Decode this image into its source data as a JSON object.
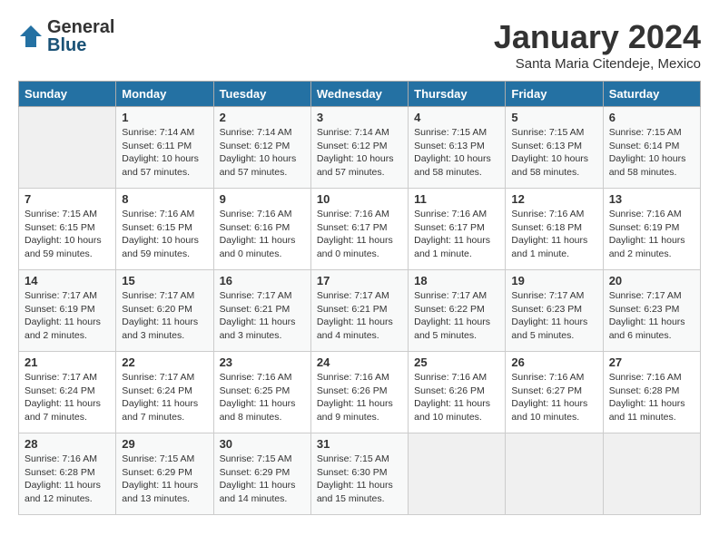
{
  "logo": {
    "general": "General",
    "blue": "Blue"
  },
  "title": "January 2024",
  "location": "Santa Maria Citendeje, Mexico",
  "header_days": [
    "Sunday",
    "Monday",
    "Tuesday",
    "Wednesday",
    "Thursday",
    "Friday",
    "Saturday"
  ],
  "weeks": [
    [
      {
        "day": "",
        "info": ""
      },
      {
        "day": "1",
        "info": "Sunrise: 7:14 AM\nSunset: 6:11 PM\nDaylight: 10 hours\nand 57 minutes."
      },
      {
        "day": "2",
        "info": "Sunrise: 7:14 AM\nSunset: 6:12 PM\nDaylight: 10 hours\nand 57 minutes."
      },
      {
        "day": "3",
        "info": "Sunrise: 7:14 AM\nSunset: 6:12 PM\nDaylight: 10 hours\nand 57 minutes."
      },
      {
        "day": "4",
        "info": "Sunrise: 7:15 AM\nSunset: 6:13 PM\nDaylight: 10 hours\nand 58 minutes."
      },
      {
        "day": "5",
        "info": "Sunrise: 7:15 AM\nSunset: 6:13 PM\nDaylight: 10 hours\nand 58 minutes."
      },
      {
        "day": "6",
        "info": "Sunrise: 7:15 AM\nSunset: 6:14 PM\nDaylight: 10 hours\nand 58 minutes."
      }
    ],
    [
      {
        "day": "7",
        "info": "Sunrise: 7:15 AM\nSunset: 6:15 PM\nDaylight: 10 hours\nand 59 minutes."
      },
      {
        "day": "8",
        "info": "Sunrise: 7:16 AM\nSunset: 6:15 PM\nDaylight: 10 hours\nand 59 minutes."
      },
      {
        "day": "9",
        "info": "Sunrise: 7:16 AM\nSunset: 6:16 PM\nDaylight: 11 hours\nand 0 minutes."
      },
      {
        "day": "10",
        "info": "Sunrise: 7:16 AM\nSunset: 6:17 PM\nDaylight: 11 hours\nand 0 minutes."
      },
      {
        "day": "11",
        "info": "Sunrise: 7:16 AM\nSunset: 6:17 PM\nDaylight: 11 hours\nand 1 minute."
      },
      {
        "day": "12",
        "info": "Sunrise: 7:16 AM\nSunset: 6:18 PM\nDaylight: 11 hours\nand 1 minute."
      },
      {
        "day": "13",
        "info": "Sunrise: 7:16 AM\nSunset: 6:19 PM\nDaylight: 11 hours\nand 2 minutes."
      }
    ],
    [
      {
        "day": "14",
        "info": "Sunrise: 7:17 AM\nSunset: 6:19 PM\nDaylight: 11 hours\nand 2 minutes."
      },
      {
        "day": "15",
        "info": "Sunrise: 7:17 AM\nSunset: 6:20 PM\nDaylight: 11 hours\nand 3 minutes."
      },
      {
        "day": "16",
        "info": "Sunrise: 7:17 AM\nSunset: 6:21 PM\nDaylight: 11 hours\nand 3 minutes."
      },
      {
        "day": "17",
        "info": "Sunrise: 7:17 AM\nSunset: 6:21 PM\nDaylight: 11 hours\nand 4 minutes."
      },
      {
        "day": "18",
        "info": "Sunrise: 7:17 AM\nSunset: 6:22 PM\nDaylight: 11 hours\nand 5 minutes."
      },
      {
        "day": "19",
        "info": "Sunrise: 7:17 AM\nSunset: 6:23 PM\nDaylight: 11 hours\nand 5 minutes."
      },
      {
        "day": "20",
        "info": "Sunrise: 7:17 AM\nSunset: 6:23 PM\nDaylight: 11 hours\nand 6 minutes."
      }
    ],
    [
      {
        "day": "21",
        "info": "Sunrise: 7:17 AM\nSunset: 6:24 PM\nDaylight: 11 hours\nand 7 minutes."
      },
      {
        "day": "22",
        "info": "Sunrise: 7:17 AM\nSunset: 6:24 PM\nDaylight: 11 hours\nand 7 minutes."
      },
      {
        "day": "23",
        "info": "Sunrise: 7:16 AM\nSunset: 6:25 PM\nDaylight: 11 hours\nand 8 minutes."
      },
      {
        "day": "24",
        "info": "Sunrise: 7:16 AM\nSunset: 6:26 PM\nDaylight: 11 hours\nand 9 minutes."
      },
      {
        "day": "25",
        "info": "Sunrise: 7:16 AM\nSunset: 6:26 PM\nDaylight: 11 hours\nand 10 minutes."
      },
      {
        "day": "26",
        "info": "Sunrise: 7:16 AM\nSunset: 6:27 PM\nDaylight: 11 hours\nand 10 minutes."
      },
      {
        "day": "27",
        "info": "Sunrise: 7:16 AM\nSunset: 6:28 PM\nDaylight: 11 hours\nand 11 minutes."
      }
    ],
    [
      {
        "day": "28",
        "info": "Sunrise: 7:16 AM\nSunset: 6:28 PM\nDaylight: 11 hours\nand 12 minutes."
      },
      {
        "day": "29",
        "info": "Sunrise: 7:15 AM\nSunset: 6:29 PM\nDaylight: 11 hours\nand 13 minutes."
      },
      {
        "day": "30",
        "info": "Sunrise: 7:15 AM\nSunset: 6:29 PM\nDaylight: 11 hours\nand 14 minutes."
      },
      {
        "day": "31",
        "info": "Sunrise: 7:15 AM\nSunset: 6:30 PM\nDaylight: 11 hours\nand 15 minutes."
      },
      {
        "day": "",
        "info": ""
      },
      {
        "day": "",
        "info": ""
      },
      {
        "day": "",
        "info": ""
      }
    ]
  ]
}
